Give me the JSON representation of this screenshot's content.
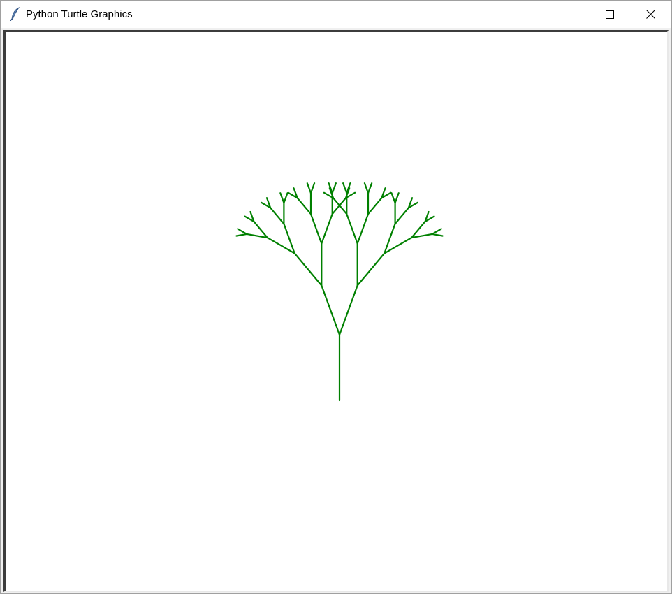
{
  "window": {
    "title": "Python Turtle Graphics",
    "icon": "feather-icon",
    "controls": {
      "minimize": "minimize-icon",
      "maximize": "maximize-icon",
      "close": "close-icon"
    }
  },
  "drawing": {
    "pen_color": "#008000",
    "background": "#ffffff",
    "shape": "fractal-tree"
  }
}
